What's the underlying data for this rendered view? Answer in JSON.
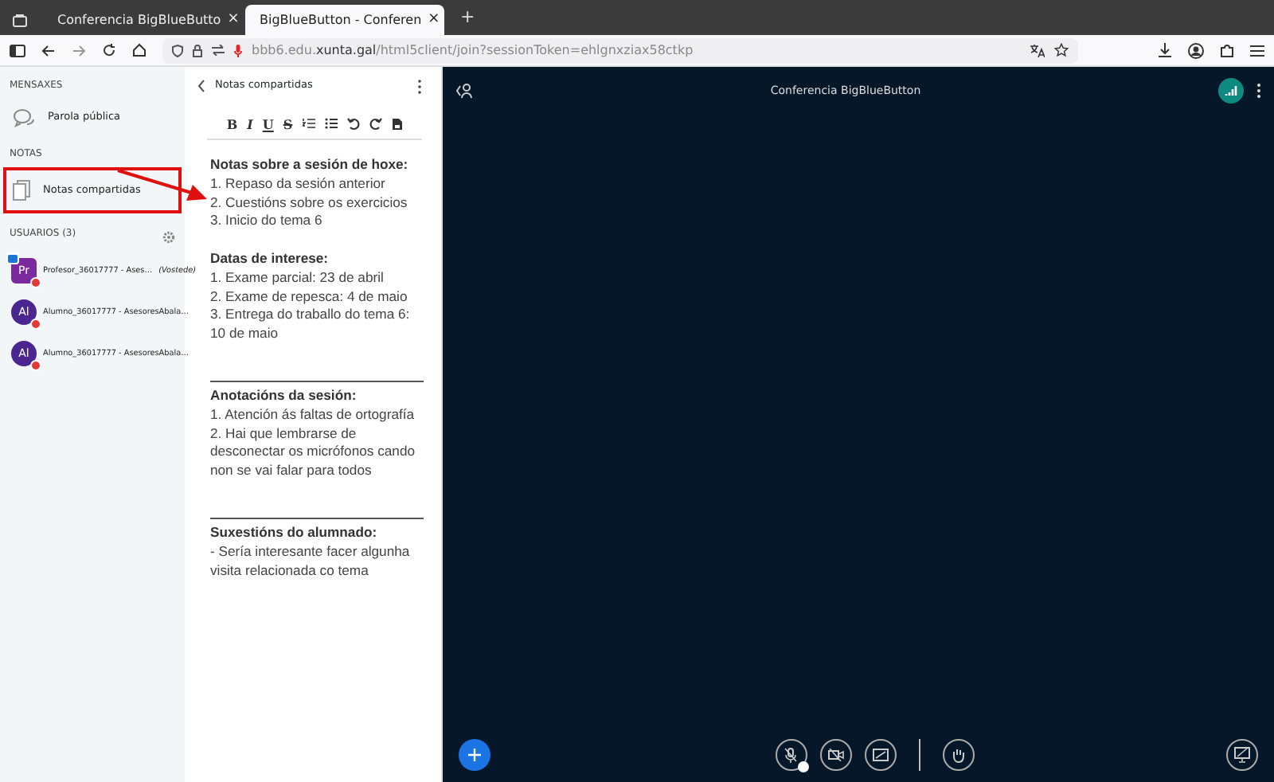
{
  "browser": {
    "tabs": [
      {
        "title": "Conferencia BigBlueButto",
        "close": "×",
        "selected": false
      },
      {
        "title": "BigBlueButton - Conferen",
        "close": "×",
        "selected": true
      }
    ],
    "new_tab": "+",
    "url": "bbb6.edu.**xunta.gal**/html5client/join?sessionToken=ehlgnxziax58ctkp"
  },
  "sidebar": {
    "messages_heading": "MENSAXES",
    "public_chat": "Parola pública",
    "notes_heading": "NOTAS",
    "shared_notes": {
      "label": "Notas compartidas",
      "highlighted": true
    },
    "users_heading": "USUARIOS (3)",
    "users": [
      {
        "initials": "Pr",
        "name": "Profesor_36017777 - Ases…",
        "suffix": "(Vostede)",
        "presenter": true,
        "color": "#7b2a9e"
      },
      {
        "initials": "Al",
        "name": "Alumno_36017777 - AsesoresAbala…",
        "presenter": false,
        "color": "#4b2590"
      },
      {
        "initials": "Al",
        "name": "Alumno_36017777 - AsesoresAbala…",
        "presenter": false,
        "color": "#4b2590"
      }
    ]
  },
  "notes_panel": {
    "title": "Notas compartidas",
    "format_buttons": [
      {
        "kind": "bold",
        "label": "B"
      },
      {
        "kind": "italic",
        "label": "I"
      },
      {
        "kind": "underline",
        "label": "U"
      },
      {
        "kind": "strike",
        "label": "S"
      }
    ],
    "sections": [
      {
        "rule": false,
        "heading": "Notas sobre a sesión de hoxe:",
        "lines": [
          "1. Repaso da sesión anterior",
          "2. Cuestións sobre os exercicios",
          "3. Inicio do tema 6"
        ]
      },
      {
        "rule": false,
        "heading": "Datas de interese:",
        "lines": [
          "1. Exame parcial: 23 de abril",
          "2. Exame de repesca: 4 de maio",
          "3. Entrega do traballo do tema 6: 10 de maio"
        ]
      },
      {
        "rule": true,
        "heading": "Anotacións da sesión:",
        "lines": [
          "1. Atención ás faltas de ortografía",
          "2. Hai que lembrarse de desconectar os micrófonos cando non se vai falar para todos"
        ]
      },
      {
        "rule": true,
        "heading": "Suxestións do alumnado:",
        "lines": [
          "- Sería interesante facer algunha visita relacionada co tema"
        ]
      }
    ]
  },
  "meeting": {
    "title": "Conferencia BigBlueButton"
  }
}
